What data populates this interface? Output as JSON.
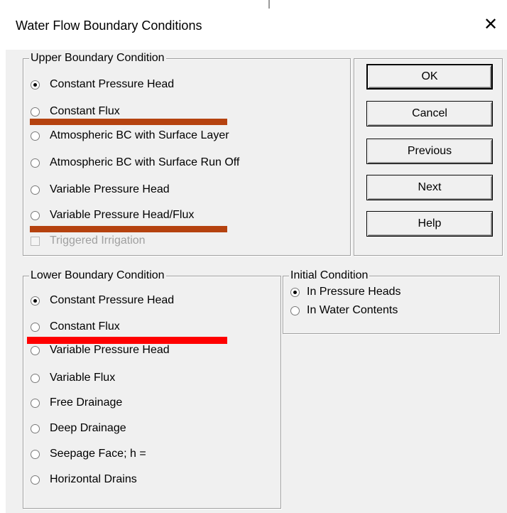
{
  "window": {
    "title": "Water Flow Boundary Conditions",
    "close_glyph": "✕"
  },
  "upper": {
    "legend": "Upper Boundary Condition",
    "options": [
      {
        "label": "Constant Pressure Head",
        "selected": true
      },
      {
        "label": "Constant Flux",
        "selected": false
      },
      {
        "label": "Atmospheric BC with Surface Layer",
        "selected": false
      },
      {
        "label": "Atmospheric BC with Surface Run Off",
        "selected": false
      },
      {
        "label": "Variable Pressure Head",
        "selected": false
      },
      {
        "label": "Variable Pressure Head/Flux",
        "selected": false
      }
    ],
    "triggered_irrigation": {
      "label": "Triggered Irrigation",
      "checked": false,
      "enabled": false
    }
  },
  "buttons": {
    "ok": "OK",
    "cancel": "Cancel",
    "previous": "Previous",
    "next": "Next",
    "help": "Help"
  },
  "lower": {
    "legend": "Lower Boundary Condition",
    "options": [
      {
        "label": "Constant Pressure Head",
        "selected": true
      },
      {
        "label": "Constant Flux",
        "selected": false
      },
      {
        "label": "Variable Pressure Head",
        "selected": false
      },
      {
        "label": "Variable Flux",
        "selected": false
      },
      {
        "label": "Free Drainage",
        "selected": false
      },
      {
        "label": "Deep Drainage",
        "selected": false
      },
      {
        "label": "Seepage Face; h =",
        "selected": false
      },
      {
        "label": "Horizontal Drains",
        "selected": false
      }
    ]
  },
  "initial": {
    "legend": "Initial Condition",
    "options": [
      {
        "label": "In Pressure Heads",
        "selected": true
      },
      {
        "label": "In Water Contents",
        "selected": false
      }
    ]
  },
  "annotations": {
    "upper_mark_color": "#b5420f",
    "lower_mark_color": "#ff0000"
  }
}
